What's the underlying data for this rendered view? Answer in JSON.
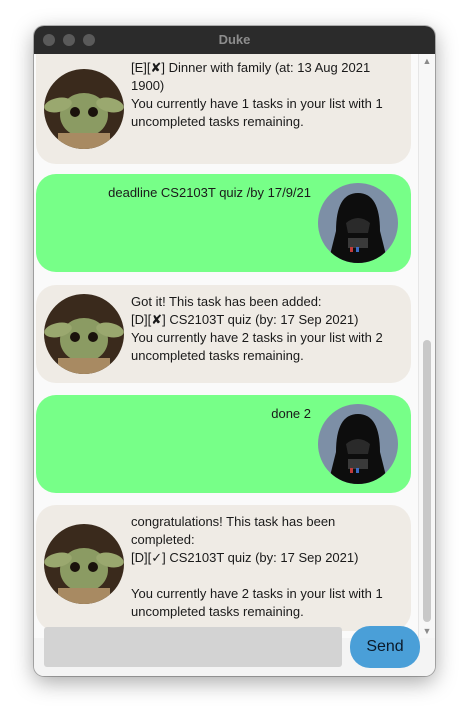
{
  "window": {
    "title": "Duke"
  },
  "messages": [
    {
      "sender": "duke",
      "text": "[E][✘] Dinner with family (at: 13 Aug 2021\n1900)\nYou currently have 1 tasks in your list with 1\nuncompleted tasks remaining."
    },
    {
      "sender": "user",
      "text": "deadline CS2103T quiz /by 17/9/21"
    },
    {
      "sender": "duke",
      "text": "Got it! This task has been added:\n[D][✘] CS2103T quiz (by: 17 Sep 2021)\nYou currently have 2 tasks in your list with 2\nuncompleted tasks remaining."
    },
    {
      "sender": "user",
      "text": "done 2"
    },
    {
      "sender": "duke",
      "text": "congratulations! This task has been\ncompleted:\n[D][✓] CS2103T quiz (by: 17 Sep 2021)\n\nYou currently have 2 tasks in your list with 1\nuncompleted tasks remaining."
    }
  ],
  "input": {
    "value": "",
    "placeholder": ""
  },
  "send_button": {
    "label": "Send"
  },
  "icons": {
    "duke_avatar": "baby-yoda-avatar-icon",
    "user_avatar": "darth-vader-avatar-icon"
  },
  "colors": {
    "duke_bubble": "#efebe5",
    "user_bubble": "#77ff88",
    "send_button": "#4a9fd8",
    "input_bg": "#d3d3d3",
    "titlebar": "#2b2b2b"
  }
}
